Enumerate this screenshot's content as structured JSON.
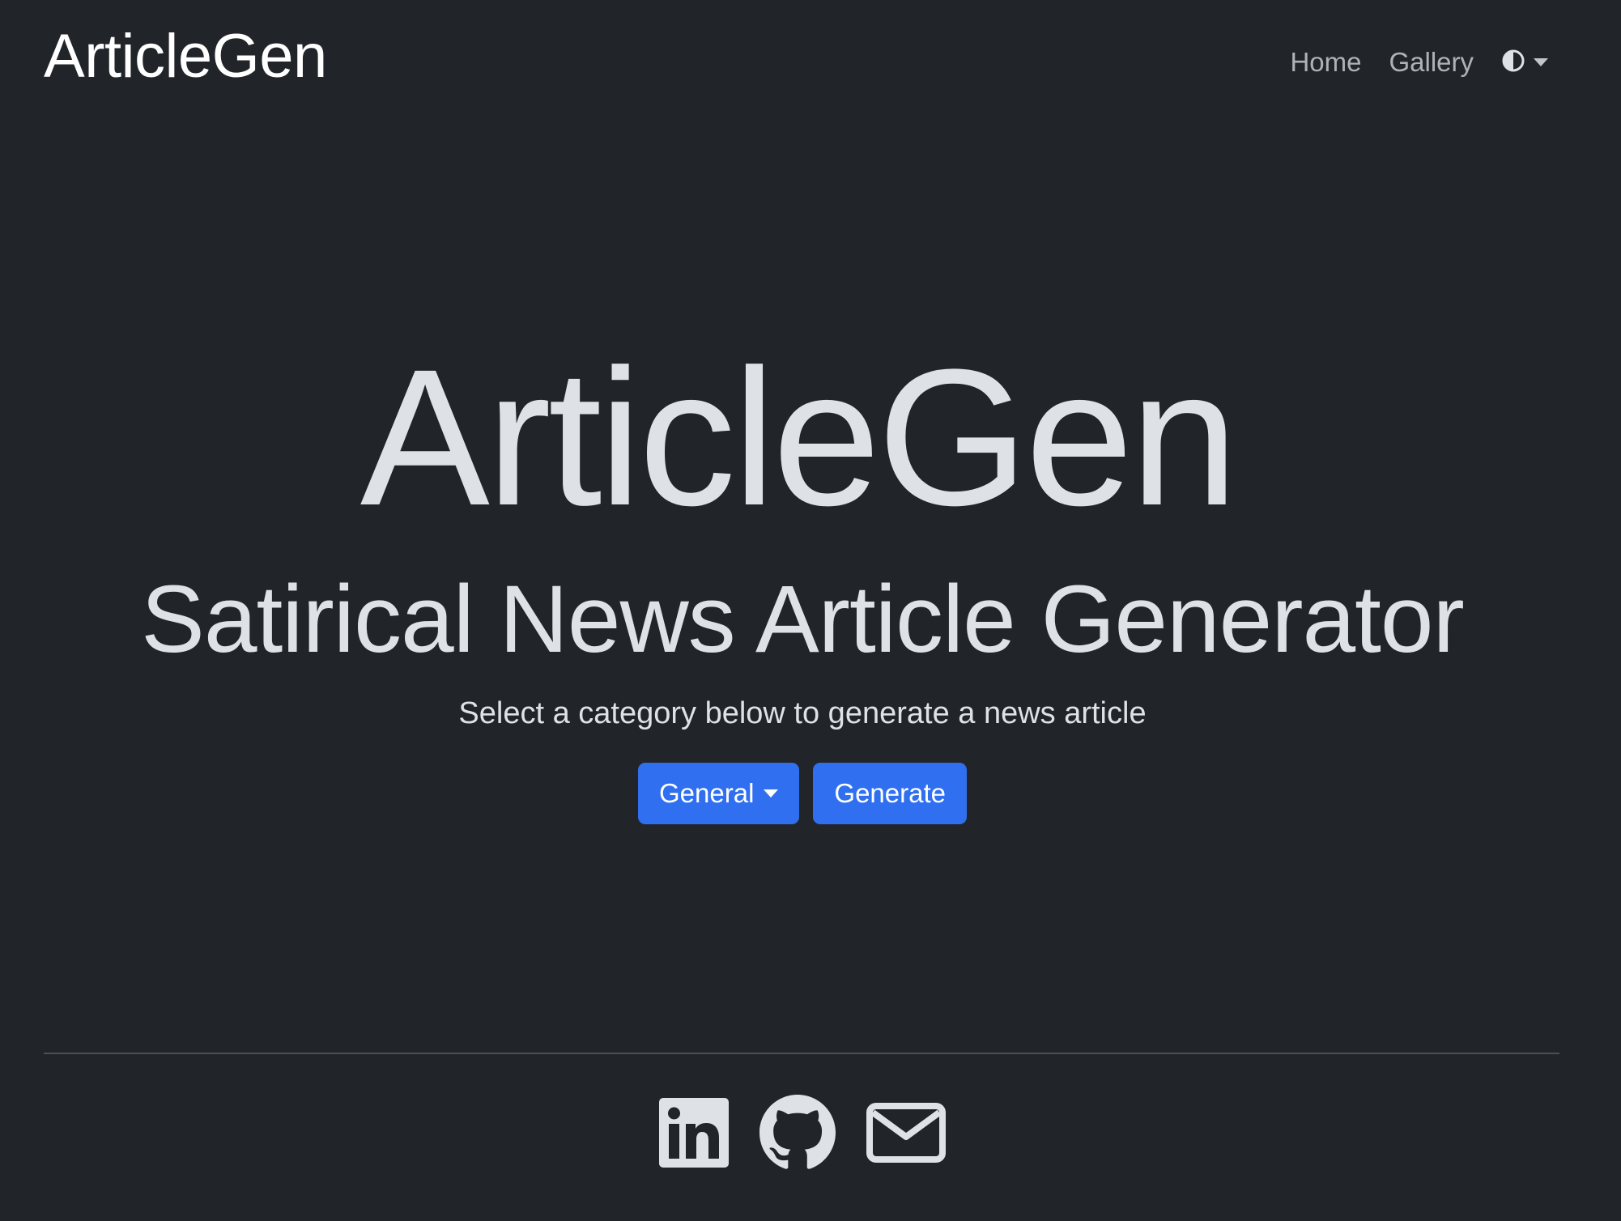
{
  "navbar": {
    "brand": "ArticleGen",
    "links": [
      "Home",
      "Gallery"
    ],
    "theme_toggle_icon": "contrast-half-circle-icon"
  },
  "hero": {
    "title": "ArticleGen",
    "subtitle": "Satirical News Article Generator",
    "lead": "Select a category below to generate a news article"
  },
  "actions": {
    "category_selected": "General",
    "generate_label": "Generate"
  },
  "footer": {
    "icons": [
      "linkedin-icon",
      "github-icon",
      "envelope-icon"
    ]
  },
  "colors": {
    "background": "#212529",
    "text": "#dee2e6",
    "primary": "#3070f0"
  }
}
